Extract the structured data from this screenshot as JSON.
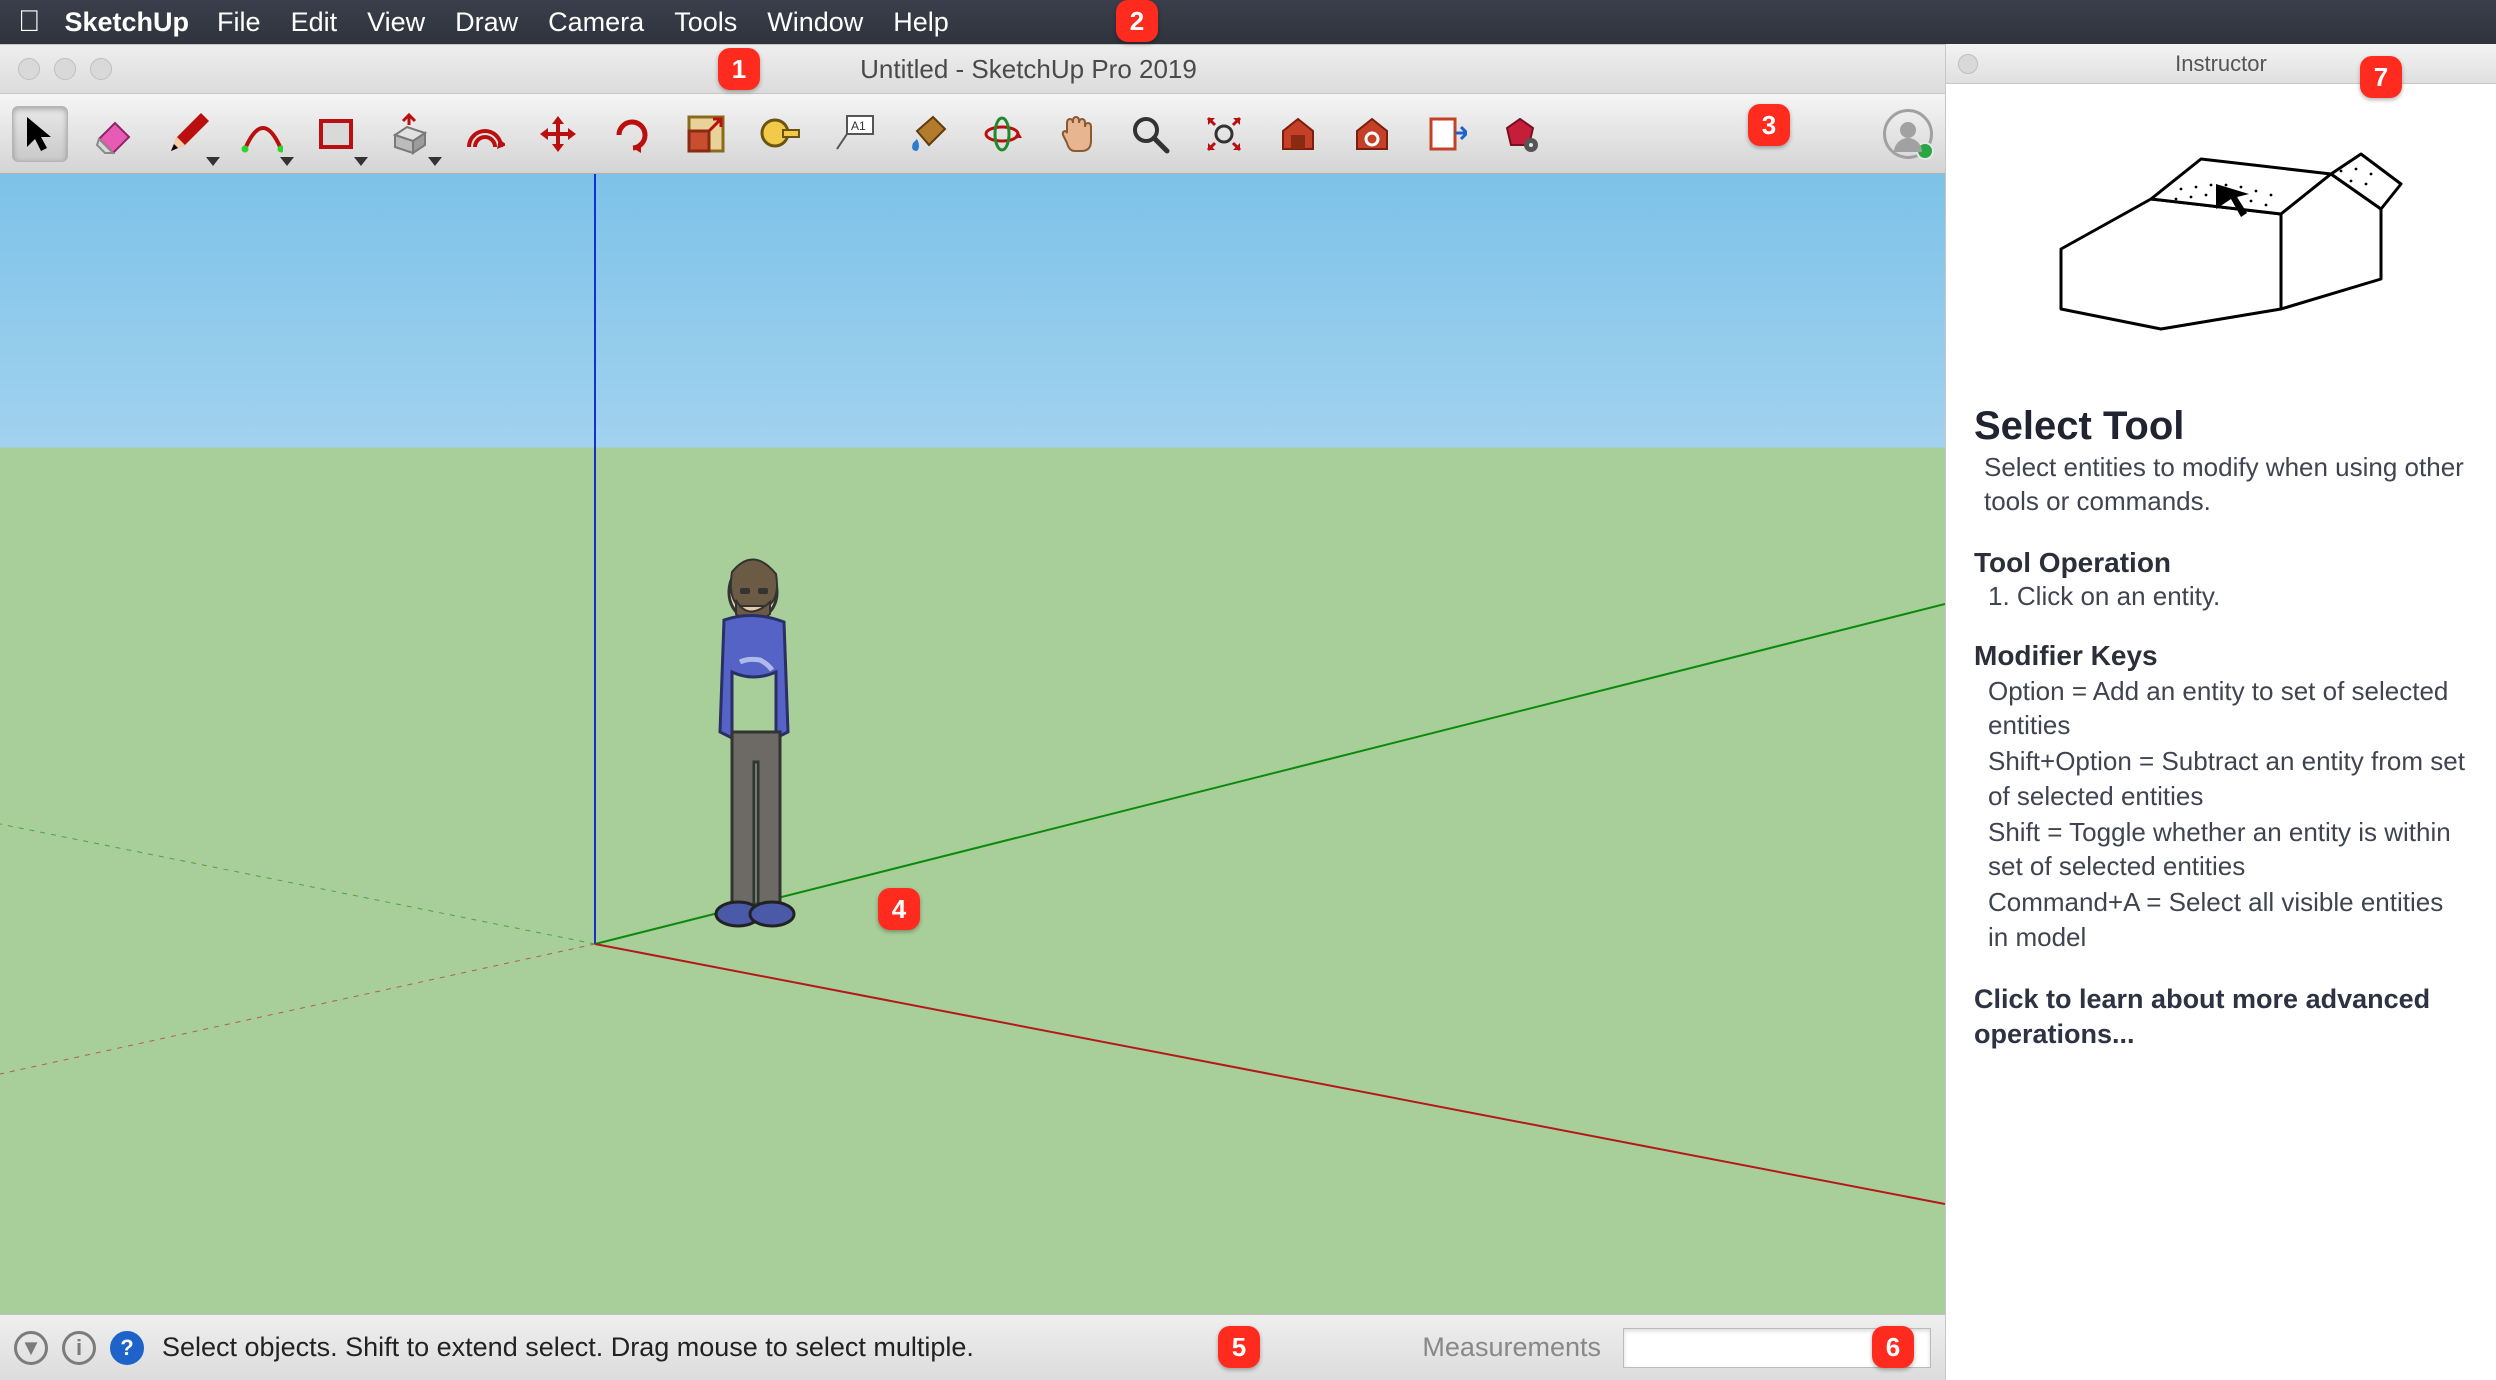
{
  "menubar": {
    "app": "SketchUp",
    "items": [
      "File",
      "Edit",
      "View",
      "Draw",
      "Camera",
      "Tools",
      "Window",
      "Help"
    ]
  },
  "window": {
    "title": "Untitled - SketchUp Pro 2019"
  },
  "toolbar": {
    "tools": [
      {
        "name": "select-tool",
        "active": true
      },
      {
        "name": "eraser-tool"
      },
      {
        "name": "line-tool",
        "dropdown": true
      },
      {
        "name": "arc-tool",
        "dropdown": true
      },
      {
        "name": "rectangle-tool",
        "dropdown": true
      },
      {
        "name": "push-pull-tool",
        "dropdown": true
      },
      {
        "name": "offset-tool"
      },
      {
        "name": "move-tool"
      },
      {
        "name": "rotate-tool"
      },
      {
        "name": "scale-tool"
      },
      {
        "name": "tape-measure-tool"
      },
      {
        "name": "text-tool"
      },
      {
        "name": "paint-bucket-tool"
      },
      {
        "name": "orbit-tool"
      },
      {
        "name": "pan-tool"
      },
      {
        "name": "zoom-tool"
      },
      {
        "name": "zoom-extents-tool"
      },
      {
        "name": "3d-warehouse-tool"
      },
      {
        "name": "extension-warehouse-tool"
      },
      {
        "name": "layout-tool"
      },
      {
        "name": "extension-manager-tool"
      }
    ]
  },
  "status": {
    "hint": "Select objects. Shift to extend select. Drag mouse to select multiple.",
    "measurements_label": "Measurements",
    "measurements_value": ""
  },
  "instructor": {
    "panel_title": "Instructor",
    "heading": "Select Tool",
    "description": "Select entities to modify when using other tools or commands.",
    "operation_heading": "Tool Operation",
    "operation_step": "1. Click on an entity.",
    "modifier_heading": "Modifier Keys",
    "modifiers": [
      "Option = Add an entity to set of selected entities",
      "Shift+Option = Subtract an entity from set of selected entities",
      "Shift = Toggle whether an entity is within set of selected entities",
      "Command+A = Select all visible entities in model"
    ],
    "learn_more": "Click to learn about more advanced operations..."
  },
  "callouts": [
    "1",
    "2",
    "3",
    "4",
    "5",
    "6",
    "7"
  ]
}
